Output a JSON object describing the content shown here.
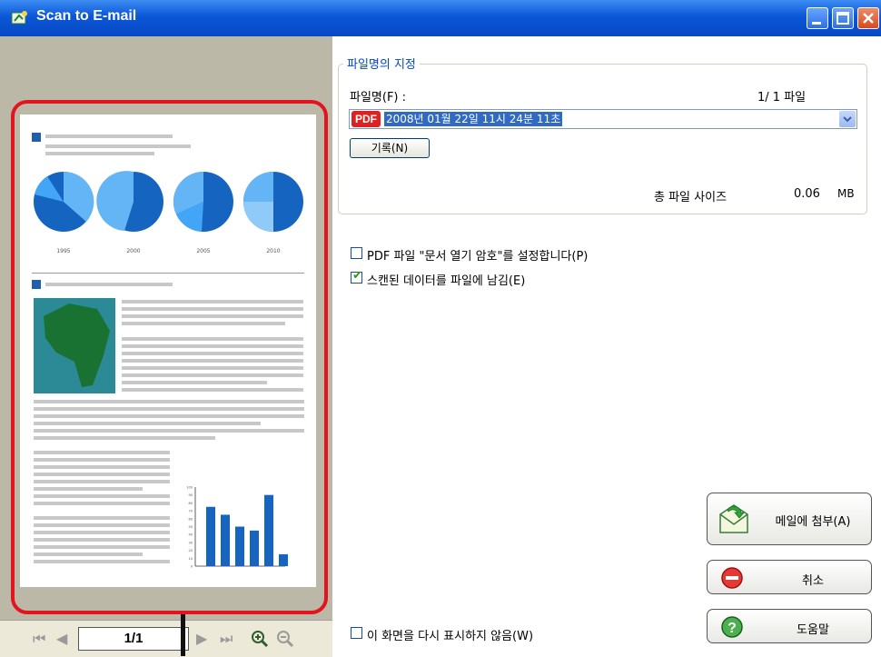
{
  "window": {
    "title": "Scan to E-mail"
  },
  "preview": {
    "page_indicator": "1/1",
    "pie_years": [
      "1995",
      "2000",
      "2005",
      "2010"
    ],
    "bar_chart_ticks": [
      "100",
      "90",
      "80",
      "70",
      "60",
      "50",
      "40",
      "30",
      "20",
      "10",
      "0"
    ],
    "bar_values": [
      75,
      65,
      50,
      45,
      90,
      15
    ]
  },
  "file_group": {
    "legend": "파일명의 지정",
    "filename_label": "파일명(F) :",
    "file_count": "1/ 1 파일",
    "filename_value": "2008년 01월 22일 11시 24분 11초",
    "pdf_badge": "PDF",
    "record_button": "기록(N)",
    "total_size_label": "총 파일 사이즈",
    "total_size_value": "0.06",
    "total_size_unit": "MB"
  },
  "options": {
    "pdf_password": {
      "label": "PDF 파일 \"문서 열기 암호\"를 설정합니다(P)",
      "checked": false
    },
    "keep_scanned": {
      "label": "스캔된 데이터를 파일에 남김(E)",
      "checked": true
    },
    "dont_show": {
      "label": "이 화면을 다시 표시하지 않음(W)",
      "checked": false
    }
  },
  "buttons": {
    "attach": "메일에 첨부(A)",
    "cancel": "취소",
    "help": "도움말"
  },
  "colors": {
    "title_bar": "#0a57d8",
    "highlight": "#e3141d",
    "selection": "#316ac5"
  }
}
